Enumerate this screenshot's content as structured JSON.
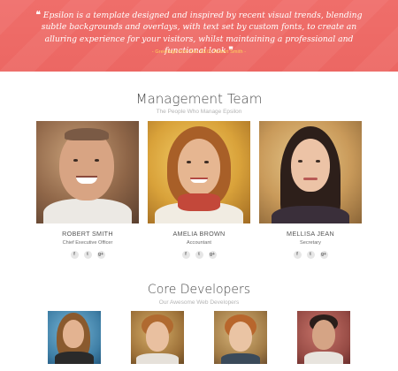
{
  "banner": {
    "quote_open": "❝",
    "quote_text": "Epsilon is a template designed and inspired by recent visual trends, blending subtle backgrounds and overlays, with text set by custom fonts, to create an alluring experience for your visitors, whilst maintaining a professional and functional look",
    "quote_close": "❞",
    "credit": "- Greetings from Our CEO, Robert Smith -",
    "color": "#ee6b67",
    "credit_color": "#ffd35c"
  },
  "management": {
    "title": "Management Team",
    "subtitle": "The People Who Manage Epsilon",
    "members": [
      {
        "name": "ROBERT SMITH",
        "role": "Chief Executive Officer",
        "socials": [
          "f",
          "t",
          "g+"
        ]
      },
      {
        "name": "AMELIA BROWN",
        "role": "Accountant",
        "socials": [
          "f",
          "t",
          "g+"
        ]
      },
      {
        "name": "MELLISA JEAN",
        "role": "Secretary",
        "socials": [
          "f",
          "t",
          "g+"
        ]
      }
    ]
  },
  "developers": {
    "title": "Core Developers",
    "subtitle": "Our Awesome Web Developers"
  },
  "icons": {
    "facebook": "facebook-icon",
    "twitter": "twitter-icon",
    "googleplus": "google-plus-icon"
  }
}
